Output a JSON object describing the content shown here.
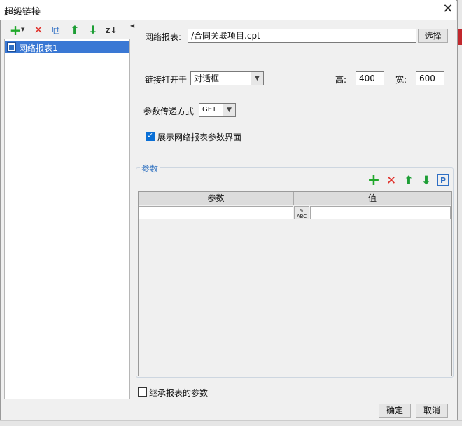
{
  "window": {
    "title": "超级链接",
    "close_glyph": "✕"
  },
  "toolbar": {
    "add": "+",
    "delete": "✕",
    "copy": "⧉",
    "up": "⬆",
    "down": "⬇",
    "sort": "z↓"
  },
  "tree": {
    "items": [
      {
        "label": "网络报表1"
      }
    ]
  },
  "report": {
    "label": "网络报表:",
    "value": "/合同关联项目.cpt",
    "select_button": "选择"
  },
  "open_in": {
    "label": "链接打开于",
    "value": "对话框",
    "height_label": "高:",
    "height_value": "400",
    "width_label": "宽:",
    "width_value": "600"
  },
  "param_mode": {
    "label": "参数传递方式",
    "value": "GET"
  },
  "show_params": {
    "label": "展示网络报表参数界面",
    "checked": true
  },
  "params": {
    "group_title": "参数",
    "columns": [
      "参数",
      "值"
    ],
    "abc_label": "ABC",
    "icons": {
      "add": "+",
      "delete": "✕",
      "up": "⬆",
      "down": "⬇",
      "p": "P"
    }
  },
  "inherit": {
    "label": "继承报表的参数",
    "checked": false
  },
  "footer": {
    "ok": "确定",
    "cancel": "取消"
  },
  "colors": {
    "selection": "#3a78d4",
    "add_green": "#20a82a",
    "delete_red": "#e0302a",
    "arrow_green": "#1d9e35",
    "group_title": "#3e7bc4"
  }
}
